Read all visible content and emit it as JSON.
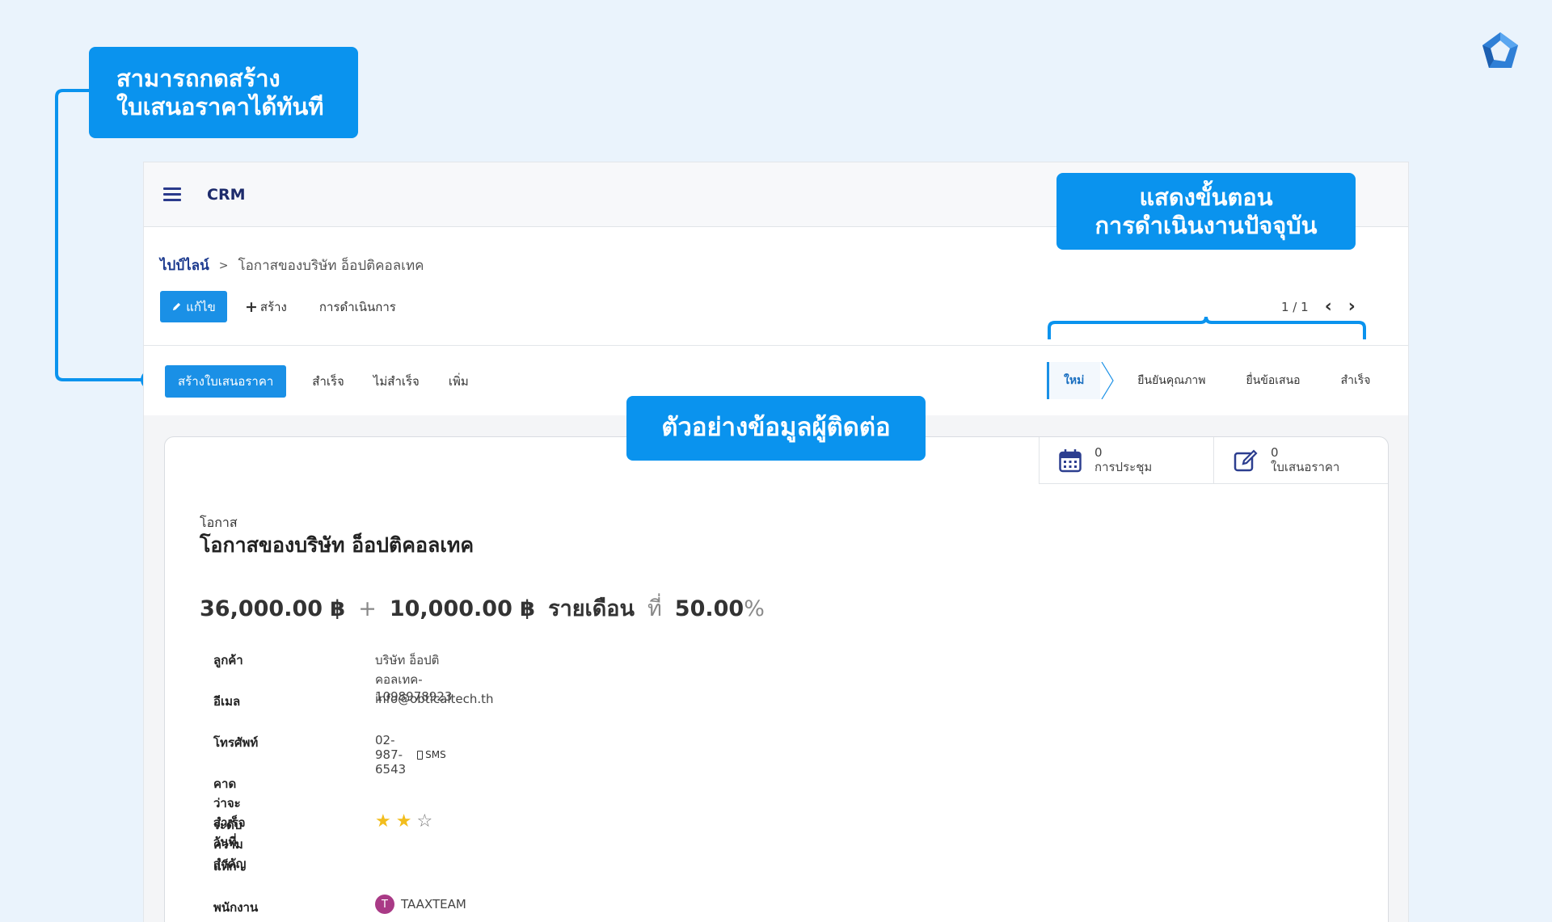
{
  "callouts": {
    "create_quote": [
      "สามารถกดสร้าง",
      "ใบเสนอราคาได้ทันที"
    ],
    "stage": [
      "แสดงขั้นตอน",
      "การดำเนินงานปัจจุบัน"
    ],
    "contact": "ตัวอย่างข้อมูลผู้ติดต่อ"
  },
  "app": {
    "title": "CRM"
  },
  "breadcrumb": {
    "parent": "ไปป์ไลน์",
    "separator": ">",
    "current": "โอกาสของบริษัท อ็อปติคอลเทค"
  },
  "actions": {
    "edit": "แก้ไข",
    "create": "สร้าง",
    "action_menu": "การดำเนินการ"
  },
  "pager": {
    "text": "1 / 1"
  },
  "status_buttons": {
    "new_quotation": "สร้างใบเสนอราคา",
    "won": "สำเร็จ",
    "lost": "ไม่สำเร็จ",
    "more": "เพิ่ม"
  },
  "stages": [
    {
      "label": "ใหม่",
      "active": true
    },
    {
      "label": "ยืนยันคุณภาพ",
      "active": false
    },
    {
      "label": "ยื่นข้อเสนอ",
      "active": false
    },
    {
      "label": "สำเร็จ",
      "active": false
    }
  ],
  "smart_buttons": {
    "meetings": {
      "count": "0",
      "label": "การประชุม"
    },
    "quotations": {
      "count": "0",
      "label": "ใบเสนอราคา"
    }
  },
  "record": {
    "type_label": "โอกาส",
    "name": "โอกาสของบริษัท อ็อปติคอลเทค",
    "expected_revenue": "36,000.00 ฿",
    "plus": "+",
    "recurring_revenue": "10,000.00 ฿",
    "recurring_plan": "รายเดือน",
    "at": "ที่",
    "probability": "50.00",
    "percent": "%"
  },
  "fields": {
    "customer": {
      "label": "ลูกค้า",
      "value": "บริษัท อ็อปติคอลเทค- 1098978923"
    },
    "email": {
      "label": "อีเมล",
      "value": "info@obticaltech.th"
    },
    "phone": {
      "label": "โทรศัพท์",
      "value": "02-987-6543",
      "sms": "SMS"
    },
    "expected_closing": {
      "label": "คาดว่าจะสำเร็จวันที่",
      "value": ""
    },
    "priority": {
      "label": "ระดับความสำคัญ",
      "stars_filled": 2,
      "stars_total": 3
    },
    "tags": {
      "label": "แท็ก",
      "value": ""
    },
    "salesperson": {
      "label": "พนักงานขาย",
      "initial": "T",
      "value": "TAAXTEAM"
    }
  },
  "colors": {
    "accent": "#1a90e6",
    "callout": "#0a93ee",
    "star": "#f2bd1d",
    "avatar": "#a93a86"
  }
}
